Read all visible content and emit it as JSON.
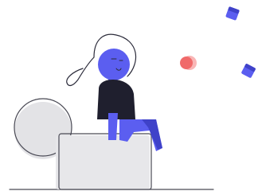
{
  "illustration": {
    "description_visible_text": "",
    "colors": {
      "background": "#ffffff",
      "accent": "#5b5ef0",
      "accent_dark": "#3f42c9",
      "hair_line": "#2b2b3a",
      "shirt": "#1f1f2e",
      "outline": "#4a4a55",
      "gray_fill": "#e3e3e6",
      "gray_light": "#f1f1f3",
      "ball_red": "#f06a6a",
      "ball_pink": "#f9b6b6"
    },
    "icons": {
      "cube_top": "floating-cube-icon",
      "cube_right": "floating-cube-icon",
      "ball": "floating-ball-icon"
    }
  }
}
